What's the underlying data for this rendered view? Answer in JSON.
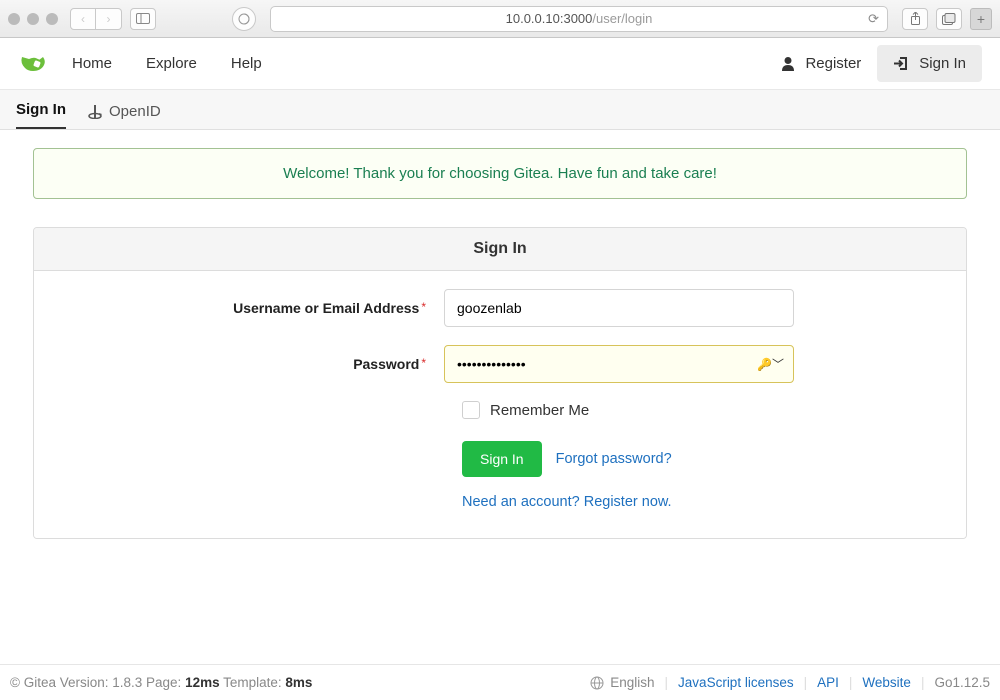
{
  "browser": {
    "url_host": "10.0.0.10:3000",
    "url_path": "/user/login"
  },
  "nav": {
    "home": "Home",
    "explore": "Explore",
    "help": "Help",
    "register": "Register",
    "signin": "Sign In"
  },
  "tabs": {
    "signin": "Sign In",
    "openid": "OpenID"
  },
  "alert": "Welcome! Thank you for choosing Gitea. Have fun and take care!",
  "panel": {
    "title": "Sign In",
    "username_label": "Username or Email Address",
    "username_value": "goozenlab",
    "password_label": "Password",
    "password_value": "••••••••••••••",
    "remember_label": "Remember Me",
    "submit": "Sign In",
    "forgot": "Forgot password?",
    "register_prompt": "Need an account? Register now."
  },
  "footer": {
    "copyright": "© Gitea Version: 1.8.3 Page: ",
    "page_time": "12ms",
    "template_label": " Template: ",
    "template_time": "8ms",
    "language": "English",
    "js_licenses": "JavaScript licenses",
    "api": "API",
    "website": "Website",
    "go_version": "Go1.12.5"
  }
}
